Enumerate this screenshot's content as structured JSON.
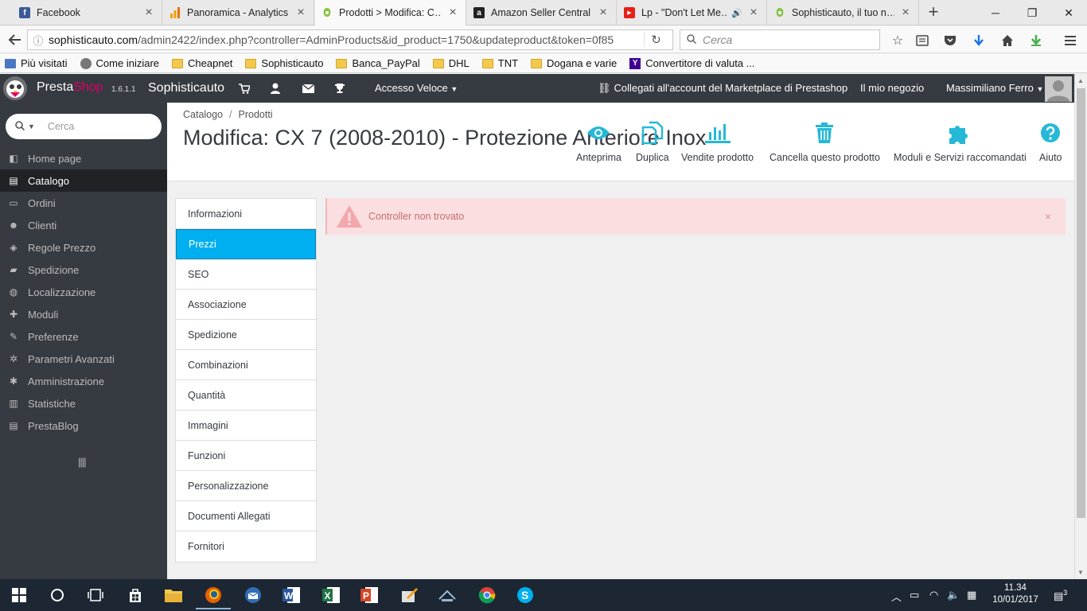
{
  "browser": {
    "tabs": [
      {
        "title": "Facebook",
        "favicon": "facebook-icon",
        "color": "#3b5998",
        "glyph": "f"
      },
      {
        "title": "Panoramica - Analytics",
        "favicon": "analytics-icon",
        "color": "#f4a000",
        "glyph": ""
      },
      {
        "title": "Prodotti > Modifica: C…",
        "favicon": "prestashop-icon",
        "color": "#8bc34a",
        "glyph": ""
      },
      {
        "title": "Amazon Seller Central",
        "favicon": "amazon-icon",
        "color": "#222222",
        "glyph": "a"
      },
      {
        "title": "Lp - \"Don't Let Me…",
        "favicon": "youtube-icon",
        "color": "#e62117",
        "glyph": "▶"
      },
      {
        "title": "Sophisticauto, il tuo n…",
        "favicon": "prestashop-icon",
        "color": "#8bc34a",
        "glyph": ""
      }
    ],
    "active_tab": 2,
    "url_host": "sophisticauto.com",
    "url_path": "/admin2422/index.php?controller=AdminProducts&id_product=1750&updateproduct&token=0f85",
    "search_placeholder": "Cerca",
    "bookmarks": [
      {
        "label": "Più visitati",
        "icon": "most-visited-icon"
      },
      {
        "label": "Come iniziare",
        "icon": "firefox-icon"
      },
      {
        "label": "Cheapnet",
        "icon": "folder-icon"
      },
      {
        "label": "Sophisticauto",
        "icon": "folder-icon"
      },
      {
        "label": "Banca_PayPal",
        "icon": "folder-icon"
      },
      {
        "label": "DHL",
        "icon": "folder-icon"
      },
      {
        "label": "TNT",
        "icon": "folder-icon"
      },
      {
        "label": "Dogana e varie",
        "icon": "folder-icon"
      },
      {
        "label": "Convertitore di valuta ...",
        "icon": "yahoo-icon"
      }
    ]
  },
  "header": {
    "brand_presta": "Presta",
    "brand_shop": "Shop",
    "version": "1.6.1.1",
    "shop_name": "Sophisticauto",
    "quick_access": "Accesso Veloce",
    "marketplace": "Collegati all'account del Marketplace di Prestashop",
    "my_shop": "Il mio negozio",
    "user": "Massimiliano Ferro"
  },
  "sidebar": {
    "search_placeholder": "Cerca",
    "items": [
      {
        "label": "Home page",
        "icon": "dashboard-icon",
        "glyph": "◧"
      },
      {
        "label": "Catalogo",
        "icon": "book-icon",
        "glyph": "▤",
        "active": true
      },
      {
        "label": "Ordini",
        "icon": "credit-card-icon",
        "glyph": "▭"
      },
      {
        "label": "Clienti",
        "icon": "users-icon",
        "glyph": "☻"
      },
      {
        "label": "Regole Prezzo",
        "icon": "tag-icon",
        "glyph": "◈"
      },
      {
        "label": "Spedizione",
        "icon": "truck-icon",
        "glyph": "▰"
      },
      {
        "label": "Localizzazione",
        "icon": "globe-icon",
        "glyph": "◍"
      },
      {
        "label": "Moduli",
        "icon": "puzzle-icon",
        "glyph": "✚"
      },
      {
        "label": "Preferenze",
        "icon": "wrench-icon",
        "glyph": "✎"
      },
      {
        "label": "Parametri Avanzati",
        "icon": "cogs-icon",
        "glyph": "✲"
      },
      {
        "label": "Amministrazione",
        "icon": "cog-icon",
        "glyph": "✱"
      },
      {
        "label": "Statistiche",
        "icon": "bar-chart-icon",
        "glyph": "▥"
      },
      {
        "label": "PrestaBlog",
        "icon": "file-icon",
        "glyph": "▤"
      }
    ]
  },
  "page": {
    "breadcrumb": [
      "Catalogo",
      "Prodotti"
    ],
    "title": "Modifica: CX 7 (2008-2010) - Protezione Anteriore Inox",
    "toolbar": [
      {
        "label": "Anteprima",
        "icon": "eye-icon"
      },
      {
        "label": "Duplica",
        "icon": "copy-icon"
      },
      {
        "label": "Vendite prodotto",
        "icon": "bar-chart-icon"
      },
      {
        "label": "Cancella questo prodotto",
        "icon": "trash-icon"
      },
      {
        "label": "Moduli e Servizi raccomandati",
        "icon": "puzzle-icon"
      },
      {
        "label": "Aiuto",
        "icon": "help-icon"
      }
    ]
  },
  "product_tabs": [
    "Informazioni",
    "Prezzi",
    "SEO",
    "Associazione",
    "Spedizione",
    "Combinazioni",
    "Quantità",
    "Immagini",
    "Funzioni",
    "Personalizzazione",
    "Documenti Allegati",
    "Fornitori"
  ],
  "active_product_tab": 1,
  "alert": {
    "message": "Controller non trovato",
    "close": "×"
  },
  "taskbar": {
    "time": "11.34",
    "date": "10/01/2017",
    "notifications": "3"
  },
  "colors": {
    "accent": "#25b9d7",
    "active_tab": "#00aff0",
    "sidebar": "#363a41",
    "alert_bg": "#fbdfe0",
    "alert_text": "#c36d6d",
    "brand_pink": "#df0067"
  }
}
